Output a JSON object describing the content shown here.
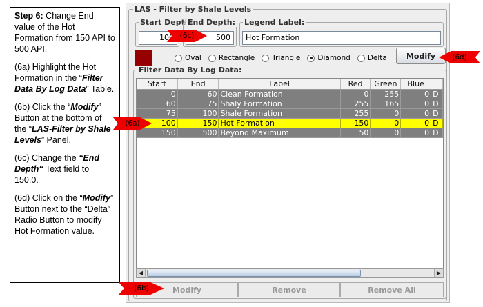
{
  "instructions": {
    "step_label": "Step 6:",
    "step_text": "Change End value of the Hot Formation from 150 API to 500 API.",
    "p6a_pre": "(6a) Highlight the Hot Formation in the “",
    "p6a_bold": "Filter Data By Log Data",
    "p6a_post": "” Table.",
    "p6b_pre": "(6b) Click the “",
    "p6b_bold": "Modify",
    "p6b_mid": "” Button at the bottom of the “",
    "p6b_bold2": "LAS-Filter by Shale Levels",
    "p6b_post": "” Panel.",
    "p6c_pre": "(6c) Change the ",
    "p6c_bold": "“End Depth“",
    "p6c_post": " Text field to 150.0.",
    "p6d_pre": "(6d) Click on the “",
    "p6d_bold": "Modify",
    "p6d_post": "” Button next to the “Delta” Radio Button to modify Hot Formation value."
  },
  "panel": {
    "title": "LAS - Filter by Shale Levels",
    "start_depth_label": "Start Depth:",
    "start_depth_value": "100",
    "end_depth_label": "End Depth:",
    "end_depth_value": "500",
    "legend_label_title": "Legend Label:",
    "legend_label_value": "Hot Formation",
    "swatch_color": "#960000",
    "shapes": [
      {
        "label": "Oval",
        "selected": false
      },
      {
        "label": "Rectangle",
        "selected": false
      },
      {
        "label": "Triangle",
        "selected": false
      },
      {
        "label": "Diamond",
        "selected": true
      },
      {
        "label": "Delta",
        "selected": false
      }
    ],
    "modify_label": "Modify",
    "filter_group_title": "Filter Data By Log Data:"
  },
  "table": {
    "columns": [
      "Start",
      "End",
      "Label",
      "Red",
      "Green",
      "Blue",
      ""
    ],
    "rows": [
      {
        "start": "0",
        "end": "60",
        "label": "Clean Formation",
        "red": "0",
        "green": "255",
        "blue": "0",
        "extra": "D",
        "selected": false
      },
      {
        "start": "60",
        "end": "75",
        "label": "Shaly Formation",
        "red": "255",
        "green": "165",
        "blue": "0",
        "extra": "D",
        "selected": false
      },
      {
        "start": "75",
        "end": "100",
        "label": "Shale Formation",
        "red": "255",
        "green": "0",
        "blue": "0",
        "extra": "D",
        "selected": false
      },
      {
        "start": "100",
        "end": "150",
        "label": "Hot Formation",
        "red": "150",
        "green": "0",
        "blue": "0",
        "extra": "D",
        "selected": true
      },
      {
        "start": "150",
        "end": "500",
        "label": "Beyond Maximum",
        "red": "50",
        "green": "0",
        "blue": "0",
        "extra": "D",
        "selected": false
      }
    ]
  },
  "bottom_buttons": {
    "modify": "Modify",
    "remove": "Remove",
    "remove_all": "Remove All"
  },
  "callouts": {
    "c6a": "(6a)",
    "c6b": "(6b)",
    "c6c": "(6c)",
    "c6d": "(6d)"
  },
  "colors": {
    "callout": "#ee0000",
    "selected_row": "#ffff00",
    "row_bg": "#7f7f7f"
  }
}
